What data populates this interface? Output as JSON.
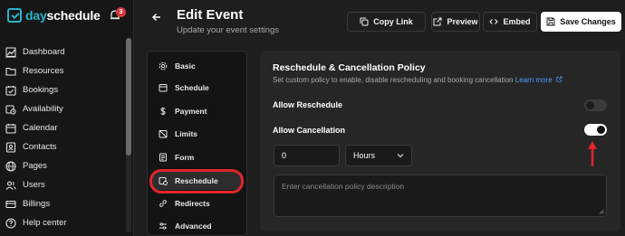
{
  "brand": {
    "name_part1": "day",
    "name_part2": "schedule",
    "notification_count": "3"
  },
  "sidebar": {
    "items": [
      {
        "label": "Dashboard",
        "icon": "dashboard-icon"
      },
      {
        "label": "Resources",
        "icon": "folder-icon"
      },
      {
        "label": "Bookings",
        "icon": "calendar-check-icon"
      },
      {
        "label": "Availability",
        "icon": "calendar-clock-icon"
      },
      {
        "label": "Calendar",
        "icon": "calendar-icon"
      },
      {
        "label": "Contacts",
        "icon": "contacts-icon"
      },
      {
        "label": "Pages",
        "icon": "globe-icon"
      },
      {
        "label": "Users",
        "icon": "users-icon"
      },
      {
        "label": "Billings",
        "icon": "credit-card-icon"
      },
      {
        "label": "Help center",
        "icon": "help-icon"
      }
    ]
  },
  "header": {
    "title": "Edit Event",
    "subtitle": "Update your event settings",
    "copy_link": "Copy Link",
    "preview": "Preview",
    "embed": "Embed",
    "save": "Save Changes"
  },
  "subnav": {
    "items": [
      {
        "label": "Basic",
        "icon": "gear-icon"
      },
      {
        "label": "Schedule",
        "icon": "calendar-icon"
      },
      {
        "label": "Payment",
        "icon": "dollar-icon"
      },
      {
        "label": "Limits",
        "icon": "calendar-off-icon"
      },
      {
        "label": "Form",
        "icon": "form-icon"
      },
      {
        "label": "Reschedule",
        "icon": "calendar-repeat-icon"
      },
      {
        "label": "Redirects",
        "icon": "link-icon"
      },
      {
        "label": "Advanced",
        "icon": "settings-icon"
      }
    ],
    "active": "Reschedule"
  },
  "panel": {
    "title": "Reschedule & Cancellation Policy",
    "description": "Set custom policy to enable, disable rescheduling and booking cancellation",
    "learn_more": "Learn more",
    "allow_reschedule": {
      "label": "Allow Reschedule",
      "enabled": false
    },
    "allow_cancellation": {
      "label": "Allow Cancellation",
      "enabled": true
    },
    "cancel_window_value": "0",
    "cancel_window_unit": "Hours",
    "policy_placeholder": "Enter cancellation policy description"
  },
  "colors": {
    "accent": "#27b3c8",
    "highlight_red": "#e0262b",
    "link": "#4a9eff"
  }
}
